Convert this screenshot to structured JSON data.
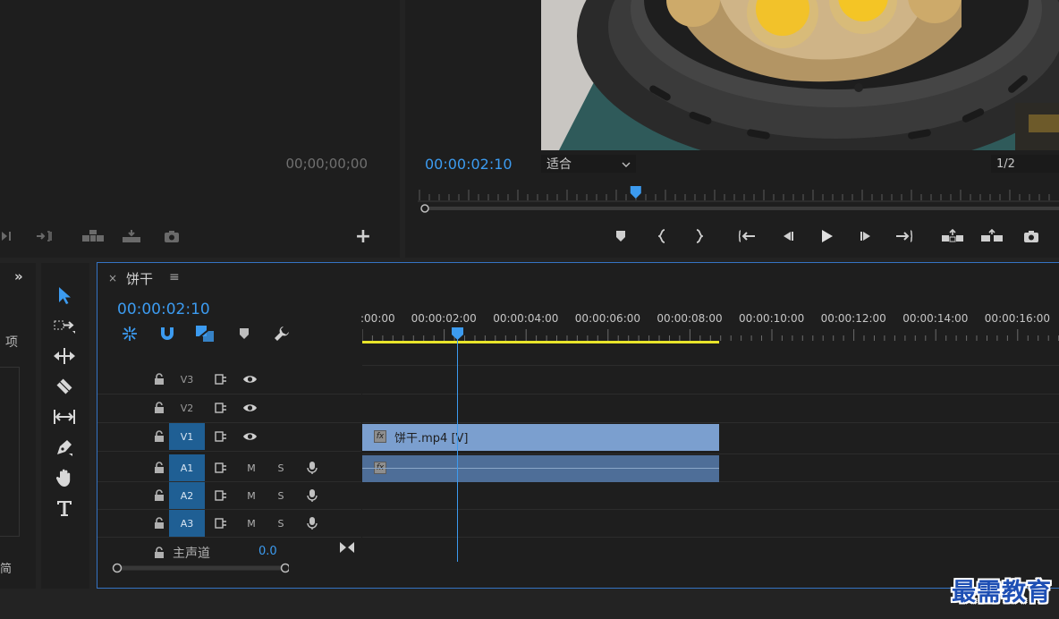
{
  "source_monitor": {
    "timecode": "00;00;00;00",
    "controls": [
      "mark-out-icon",
      "insert-icon",
      "overwrite-icon",
      "export-frame-icon"
    ],
    "add_button": "+"
  },
  "program_monitor": {
    "timecode": "00:00:02:10",
    "zoom_value": "适合",
    "resolution_value": "1/2",
    "controls": [
      "marker-icon",
      "mark-in-icon",
      "mark-out-icon",
      "go-to-in-icon",
      "step-back-icon",
      "play-icon",
      "step-forward-icon",
      "go-to-out-icon",
      "lift-icon",
      "extract-icon",
      "export-frame-icon"
    ],
    "playhead_fraction": 0.34
  },
  "project_panel": {
    "overflow": "»",
    "item_label": "项",
    "bottom_label": "简"
  },
  "timeline": {
    "close": "×",
    "sequence_name": "饼干",
    "menu": "≡",
    "timecode": "00:00:02:10",
    "ruler_labels": [
      ":00:00",
      "00:00:02:00",
      "00:00:04:00",
      "00:00:06:00",
      "00:00:08:00",
      "00:00:10:00",
      "00:00:12:00",
      "00:00:14:00",
      "00:00:16:00"
    ],
    "video_tracks": [
      {
        "name": "V3",
        "active": false
      },
      {
        "name": "V2",
        "active": false
      },
      {
        "name": "V1",
        "active": true
      }
    ],
    "audio_tracks": [
      {
        "name": "A1",
        "active": true,
        "m": "M",
        "s": "S"
      },
      {
        "name": "A2",
        "active": true,
        "m": "M",
        "s": "S"
      },
      {
        "name": "A3",
        "active": true,
        "m": "M",
        "s": "S"
      }
    ],
    "master": {
      "label": "主声道",
      "value": "0.0"
    },
    "video_clip": {
      "label": "饼干.mp4 [V]",
      "fx": "fx"
    },
    "audio_clip": {
      "fx": "fx"
    }
  },
  "tools": [
    "selection-tool-icon",
    "track-select-tool-icon",
    "ripple-edit-tool-icon",
    "razor-tool-icon",
    "slip-tool-icon",
    "pen-tool-icon",
    "hand-tool-icon",
    "type-tool-icon"
  ],
  "watermark": "最需教育",
  "colors": {
    "accent": "#3c9bf0",
    "track_active": "#1f5f94",
    "video_clip": "#7b9fcf",
    "audio_clip": "#4e6e98",
    "render_bar": "#e8e42a"
  }
}
